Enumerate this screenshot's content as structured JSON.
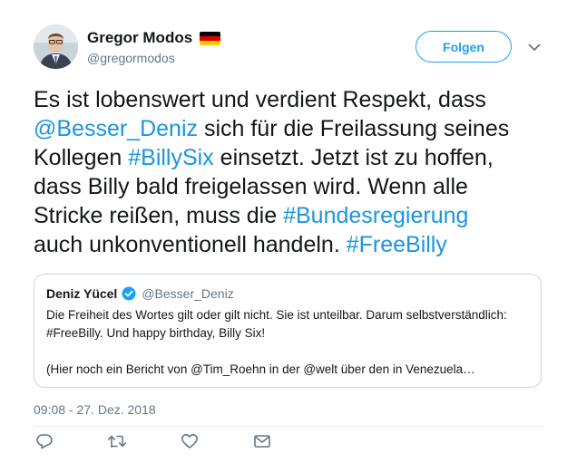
{
  "author": {
    "name": "Gregor Modos",
    "handle": "@gregormodos",
    "flag_colors": [
      "#000000",
      "#dd0000",
      "#ffce00"
    ]
  },
  "header": {
    "follow_label": "Folgen"
  },
  "tweet": {
    "lines": [
      [
        {
          "t": "Es ist lobenswert und verdient Respekt, dass",
          "link": false
        }
      ],
      [
        {
          "t": "@Besser_Deniz",
          "link": true
        },
        {
          "t": " sich für die Freilassung seines",
          "link": false
        }
      ],
      [
        {
          "t": "Kollegen ",
          "link": false
        },
        {
          "t": "#BillySix",
          "link": true
        },
        {
          "t": " einsetzt. Jetzt ist zu hoffen,",
          "link": false
        }
      ],
      [
        {
          "t": "dass Billy bald freigelassen wird. Wenn alle",
          "link": false
        }
      ],
      [
        {
          "t": "Stricke reißen, muss die ",
          "link": false
        },
        {
          "t": "#Bundesregierung",
          "link": true
        }
      ],
      [
        {
          "t": "auch unkonventionell handeln. ",
          "link": false
        },
        {
          "t": "#FreeBilly",
          "link": true
        }
      ]
    ]
  },
  "quote": {
    "name": "Deniz Yücel",
    "handle": "@Besser_Deniz",
    "lines": [
      "Die Freiheit des Wortes gilt oder gilt nicht. Sie ist unteilbar. Darum selbstverständlich:",
      "#FreeBilly. Und happy birthday, Billy Six!",
      "",
      "(Hier noch ein Bericht von @Tim_Roehn in der @welt über den in Venezuela…"
    ]
  },
  "timestamp": "09:08 - 27. Dez. 2018",
  "actions": [
    {
      "name": "reply",
      "icon": "reply-icon"
    },
    {
      "name": "retweet",
      "icon": "retweet-icon"
    },
    {
      "name": "like",
      "icon": "heart-icon"
    },
    {
      "name": "direct-message",
      "icon": "envelope-icon"
    }
  ],
  "colors": {
    "link": "#1b95e0",
    "accent": "#1da1f2",
    "secondary_text": "#657786",
    "border": "#ccd6dd"
  }
}
